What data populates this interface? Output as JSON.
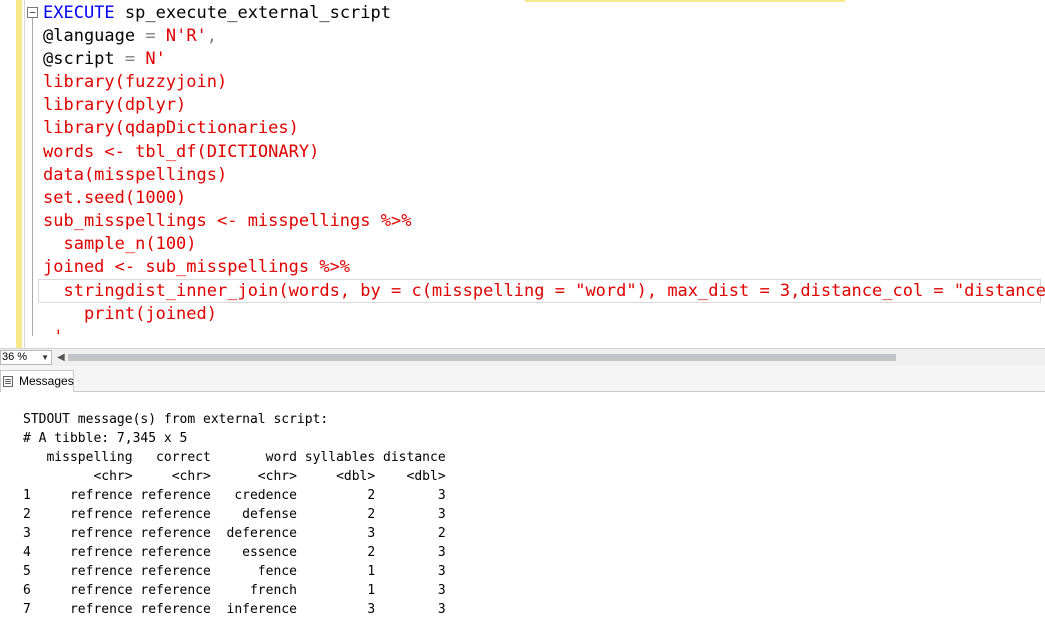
{
  "editor": {
    "line1": {
      "keyword": "EXECUTE",
      "name": " sp_execute_external_script"
    },
    "line2": {
      "param": "@language",
      "eq": " = ",
      "value": "N'R'",
      "comma": ","
    },
    "line3": {
      "param": "@script",
      "eq": " = ",
      "value": "N'"
    },
    "script_lines": [
      "library(fuzzyjoin)",
      "library(dplyr)",
      "library(qdapDictionaries)",
      "words <- tbl_df(DICTIONARY)",
      "data(misspellings)",
      "set.seed(1000)",
      "sub_misspellings <- misspellings %>%",
      "  sample_n(100)",
      "joined <- sub_misspellings %>%",
      "  stringdist_inner_join(words, by = c(misspelling = \"word\"), max_dist = 3,distance_col = \"distance\")",
      "    print(joined)",
      " '"
    ]
  },
  "status": {
    "zoom": "36 %"
  },
  "results": {
    "tab_label": "Messages",
    "output_lines": [
      "STDOUT message(s) from external script:",
      "# A tibble: 7,345 x 5",
      "   misspelling   correct       word syllables distance",
      "         <chr>     <chr>      <chr>     <dbl>    <dbl>",
      "1     refrence reference   credence         2        3",
      "2     refrence reference    defense         2        3",
      "3     refrence reference  deference         3        2",
      "4     refrence reference    essence         2        3",
      "5     refrence reference      fence         1        3",
      "6     refrence reference     french         1        3",
      "7     refrence reference  inference         3        3"
    ]
  },
  "colors": {
    "keyword": "#0000ff",
    "string": "#e00000",
    "operator": "#808080"
  }
}
